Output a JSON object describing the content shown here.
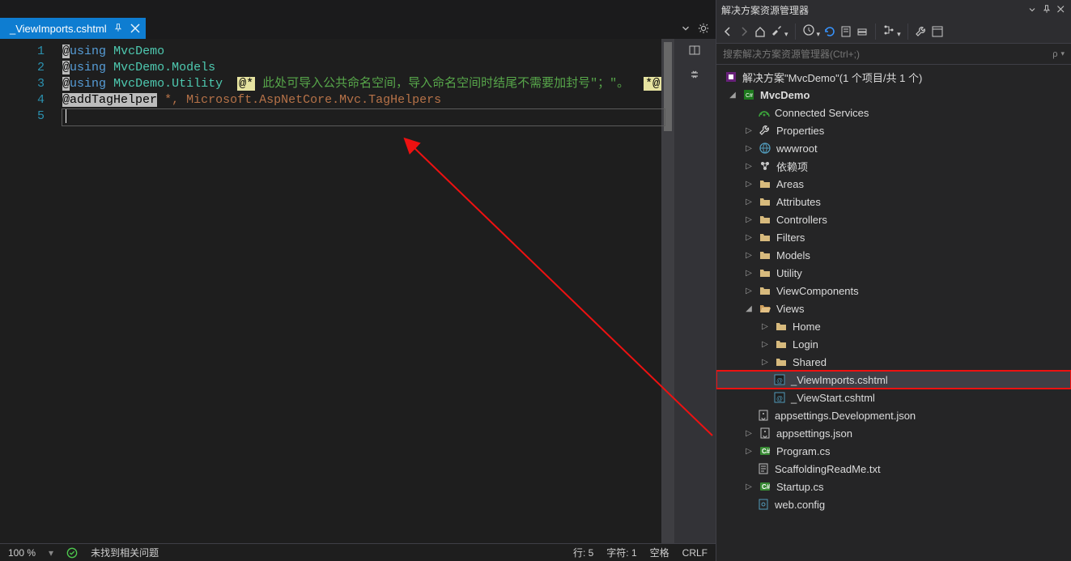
{
  "tab": {
    "filename": "_ViewImports.cshtml"
  },
  "code": {
    "using": "using",
    "addTagHelper": "@addTagHelper",
    "ns1": "MvcDemo",
    "ns2": "MvcDemo.Models",
    "ns3": "MvcDemo.Utility",
    "comment": "此处可导入公共命名空间，导入命名空间时结尾不需要加封号\"；\"。",
    "tagHelpers": "*, Microsoft.AspNetCore.Mvc.TagHelpers",
    "line_numbers": [
      "1",
      "2",
      "3",
      "4",
      "5"
    ]
  },
  "status": {
    "zoom": "100 %",
    "no_issues": "未找到相关问题",
    "line": "行: 5",
    "col": "字符: 1",
    "spaces": "空格",
    "crlf": "CRLF"
  },
  "explorer": {
    "title": "解决方案资源管理器",
    "search_placeholder": "搜索解决方案资源管理器(Ctrl+;)",
    "solution": "解决方案\"MvcDemo\"(1 个项目/共 1 个)",
    "project": "MvcDemo",
    "nodes": {
      "connected": "Connected Services",
      "properties": "Properties",
      "wwwroot": "wwwroot",
      "deps": "依赖项",
      "areas": "Areas",
      "attributes": "Attributes",
      "controllers": "Controllers",
      "filters": "Filters",
      "models": "Models",
      "utility": "Utility",
      "viewcomponents": "ViewComponents",
      "views": "Views",
      "home": "Home",
      "login": "Login",
      "shared": "Shared",
      "viewimports": "_ViewImports.cshtml",
      "viewstart": "_ViewStart.cshtml",
      "appsettings_dev": "appsettings.Development.json",
      "appsettings": "appsettings.json",
      "program": "Program.cs",
      "scaffold": "ScaffoldingReadMe.txt",
      "startup": "Startup.cs",
      "webconfig": "web.config"
    }
  }
}
